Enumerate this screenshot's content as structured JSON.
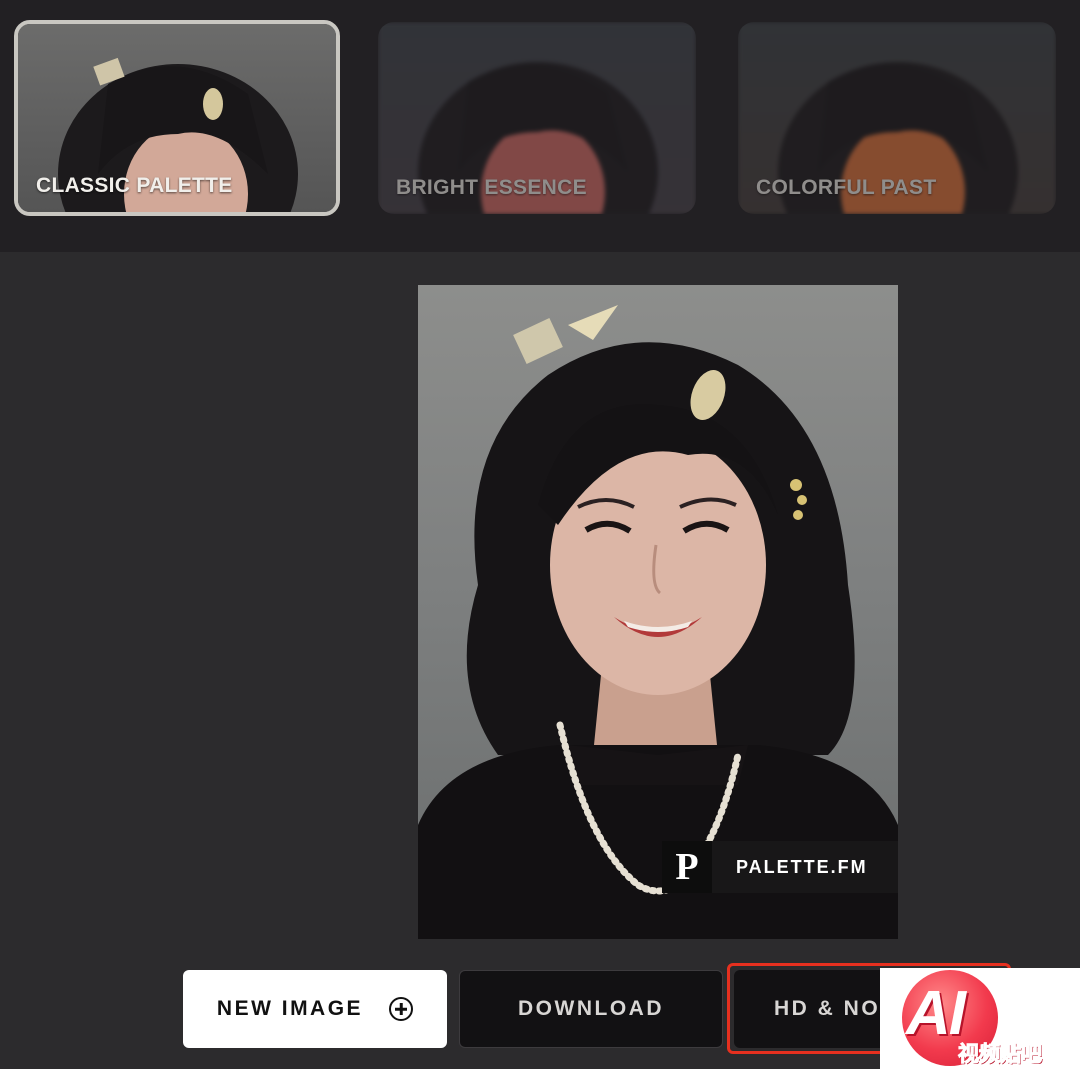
{
  "filters": [
    {
      "label": "CLASSIC PALETTE",
      "selected": true
    },
    {
      "label": "BRIGHT ESSENCE",
      "selected": false
    },
    {
      "label": "COLORFUL PAST",
      "selected": false
    }
  ],
  "photo": {
    "watermark_logo": "P",
    "watermark_text": "PALETTE.FM"
  },
  "actions": {
    "new_image_label": "NEW IMAGE",
    "new_image_icon": "plus-circle-icon",
    "download_label": "DOWNLOAD",
    "hd_label": "HD & NO"
  },
  "badge": {
    "ai_text": "AI",
    "cn_text": "视频贴吧"
  },
  "colors": {
    "background": "#2c2b2d",
    "strip": "#222023",
    "highlight_outline": "#e6301f",
    "badge_red": "#f23a4d"
  }
}
